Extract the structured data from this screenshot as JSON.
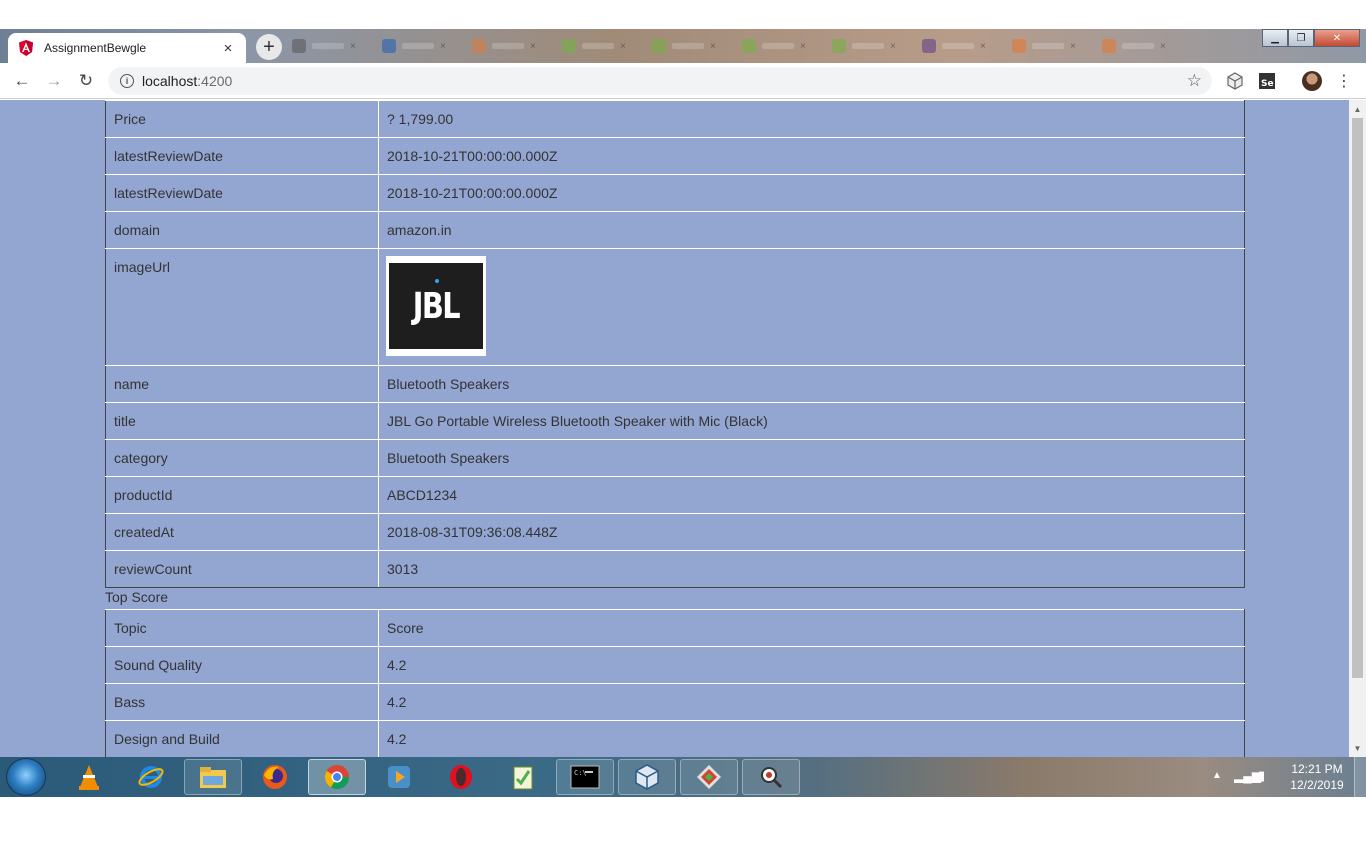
{
  "browser": {
    "tab_title": "AssignmentBewgle",
    "tab_close": "×",
    "new_tab": "+",
    "address_host": "localhost",
    "address_port": ":4200",
    "bookmark_star": "☆",
    "menu": "⋮",
    "back": "←",
    "forward": "→",
    "reload": "↻",
    "info": "i"
  },
  "product_table": {
    "rows": [
      {
        "key": "Price",
        "value": "? 1,799.00"
      },
      {
        "key": "latestReviewDate",
        "value": "2018-10-21T00:00:00.000Z"
      },
      {
        "key": "latestReviewDate",
        "value": "2018-10-21T00:00:00.000Z"
      },
      {
        "key": "domain",
        "value": "amazon.in"
      },
      {
        "key": "imageUrl",
        "value": "JBL"
      },
      {
        "key": "name",
        "value": "Bluetooth Speakers"
      },
      {
        "key": "title",
        "value": "JBL Go Portable Wireless Bluetooth Speaker with Mic (Black)"
      },
      {
        "key": "category",
        "value": "Bluetooth Speakers"
      },
      {
        "key": "productId",
        "value": "ABCD1234"
      },
      {
        "key": "createdAt",
        "value": "2018-08-31T09:36:08.448Z"
      },
      {
        "key": "reviewCount",
        "value": "3013"
      }
    ]
  },
  "top_score": {
    "title": "Top Score",
    "header": {
      "topic": "Topic",
      "score": "Score"
    },
    "rows": [
      {
        "topic": "Sound Quality",
        "score": "4.2"
      },
      {
        "topic": "Bass",
        "score": "4.2"
      },
      {
        "topic": "Design and Build",
        "score": "4.2"
      }
    ]
  },
  "taskbar": {
    "time": "12:21 PM",
    "date": "12/2/2019",
    "tray_arrow": "▲",
    "signal": "▂▄▆",
    "power": "▮"
  },
  "colors": {
    "page_bg": "#93a6d2",
    "cell_border": "#ffffff",
    "text": "#333333"
  }
}
